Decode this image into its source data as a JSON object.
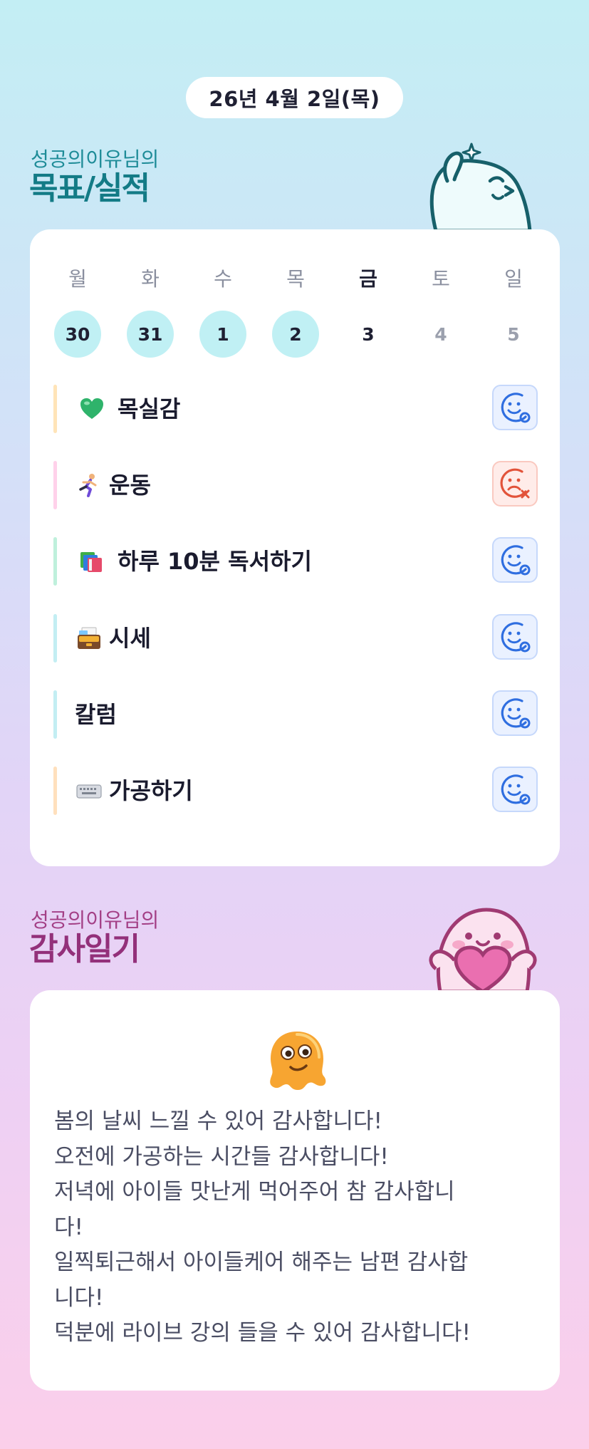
{
  "date": "26년 4월 2일(목)",
  "goals_section": {
    "subtitle": "성공의이유님의",
    "title": "목표/실적"
  },
  "week": [
    {
      "day": "월",
      "num": "30",
      "state": "done"
    },
    {
      "day": "화",
      "num": "31",
      "state": "done"
    },
    {
      "day": "수",
      "num": "1",
      "state": "done"
    },
    {
      "day": "목",
      "num": "2",
      "state": "done"
    },
    {
      "day": "금",
      "num": "3",
      "state": "today"
    },
    {
      "day": "토",
      "num": "4",
      "state": "future"
    },
    {
      "day": "일",
      "num": "5",
      "state": "future"
    }
  ],
  "goals": [
    {
      "label": "목실감",
      "icon": "green-heart-icon",
      "bar_color": "#ffe4b8",
      "status": "success"
    },
    {
      "label": "운동",
      "icon": "running-person-icon",
      "bar_color": "#ffd1ea",
      "status": "fail"
    },
    {
      "label": "하루 10분 독서하기",
      "icon": "books-icon",
      "bar_color": "#bff0dc",
      "status": "success"
    },
    {
      "label": "시세",
      "icon": "card-file-box-icon",
      "bar_color": "#c3eef3",
      "status": "success"
    },
    {
      "label": "칼럼",
      "icon": "",
      "bar_color": "#c3eef3",
      "status": "success"
    },
    {
      "label": "가공하기",
      "icon": "keyboard-icon",
      "bar_color": "#ffe0bd",
      "status": "success"
    }
  ],
  "thanks_section": {
    "subtitle": "성공의이유님의",
    "title": "감사일기"
  },
  "thanks_lines": [
    "봄의 날씨 느낄 수 있어 감사합니다!",
    "오전에 가공하는 시간들 감사합니다!",
    "저녁에 아이들 맛난게 먹어주어 참 감사합니",
    "다!",
    "일찍퇴근해서 아이들케어 해주는 남편 감사합",
    "니다!",
    "덕분에 라이브 강의 들을 수 있어 감사합니다!"
  ],
  "colors": {
    "done_circle": "#c0f0f4",
    "success_icon": "#2f6ee0",
    "fail_icon": "#e2533a",
    "goals_title": "#137b86",
    "thanks_title": "#93307a"
  }
}
